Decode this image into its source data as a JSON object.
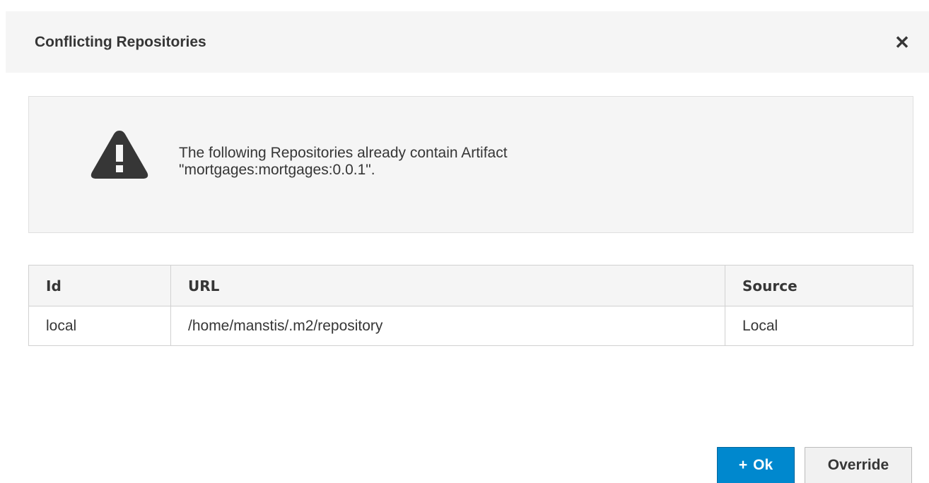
{
  "dialog": {
    "title": "Conflicting Repositories",
    "close_icon_glyph": "✕",
    "close_icon": "close-icon"
  },
  "alert": {
    "icon": "warning-icon",
    "line1": "The following Repositories already contain Artifact",
    "line2": "\"mortgages:mortgages:0.0.1\"."
  },
  "table": {
    "headers": [
      "Id",
      "URL",
      "Source"
    ],
    "rows": [
      [
        "local",
        "/home/manstis/.m2/repository",
        "Local"
      ]
    ]
  },
  "buttons": {
    "ok_icon": "plus-icon",
    "ok_icon_glyph": "+",
    "ok_label": "Ok",
    "override_label": "Override"
  },
  "colors": {
    "primary": "#0088ce",
    "header_bg": "#f5f5f5",
    "alert_icon": "#363636"
  }
}
